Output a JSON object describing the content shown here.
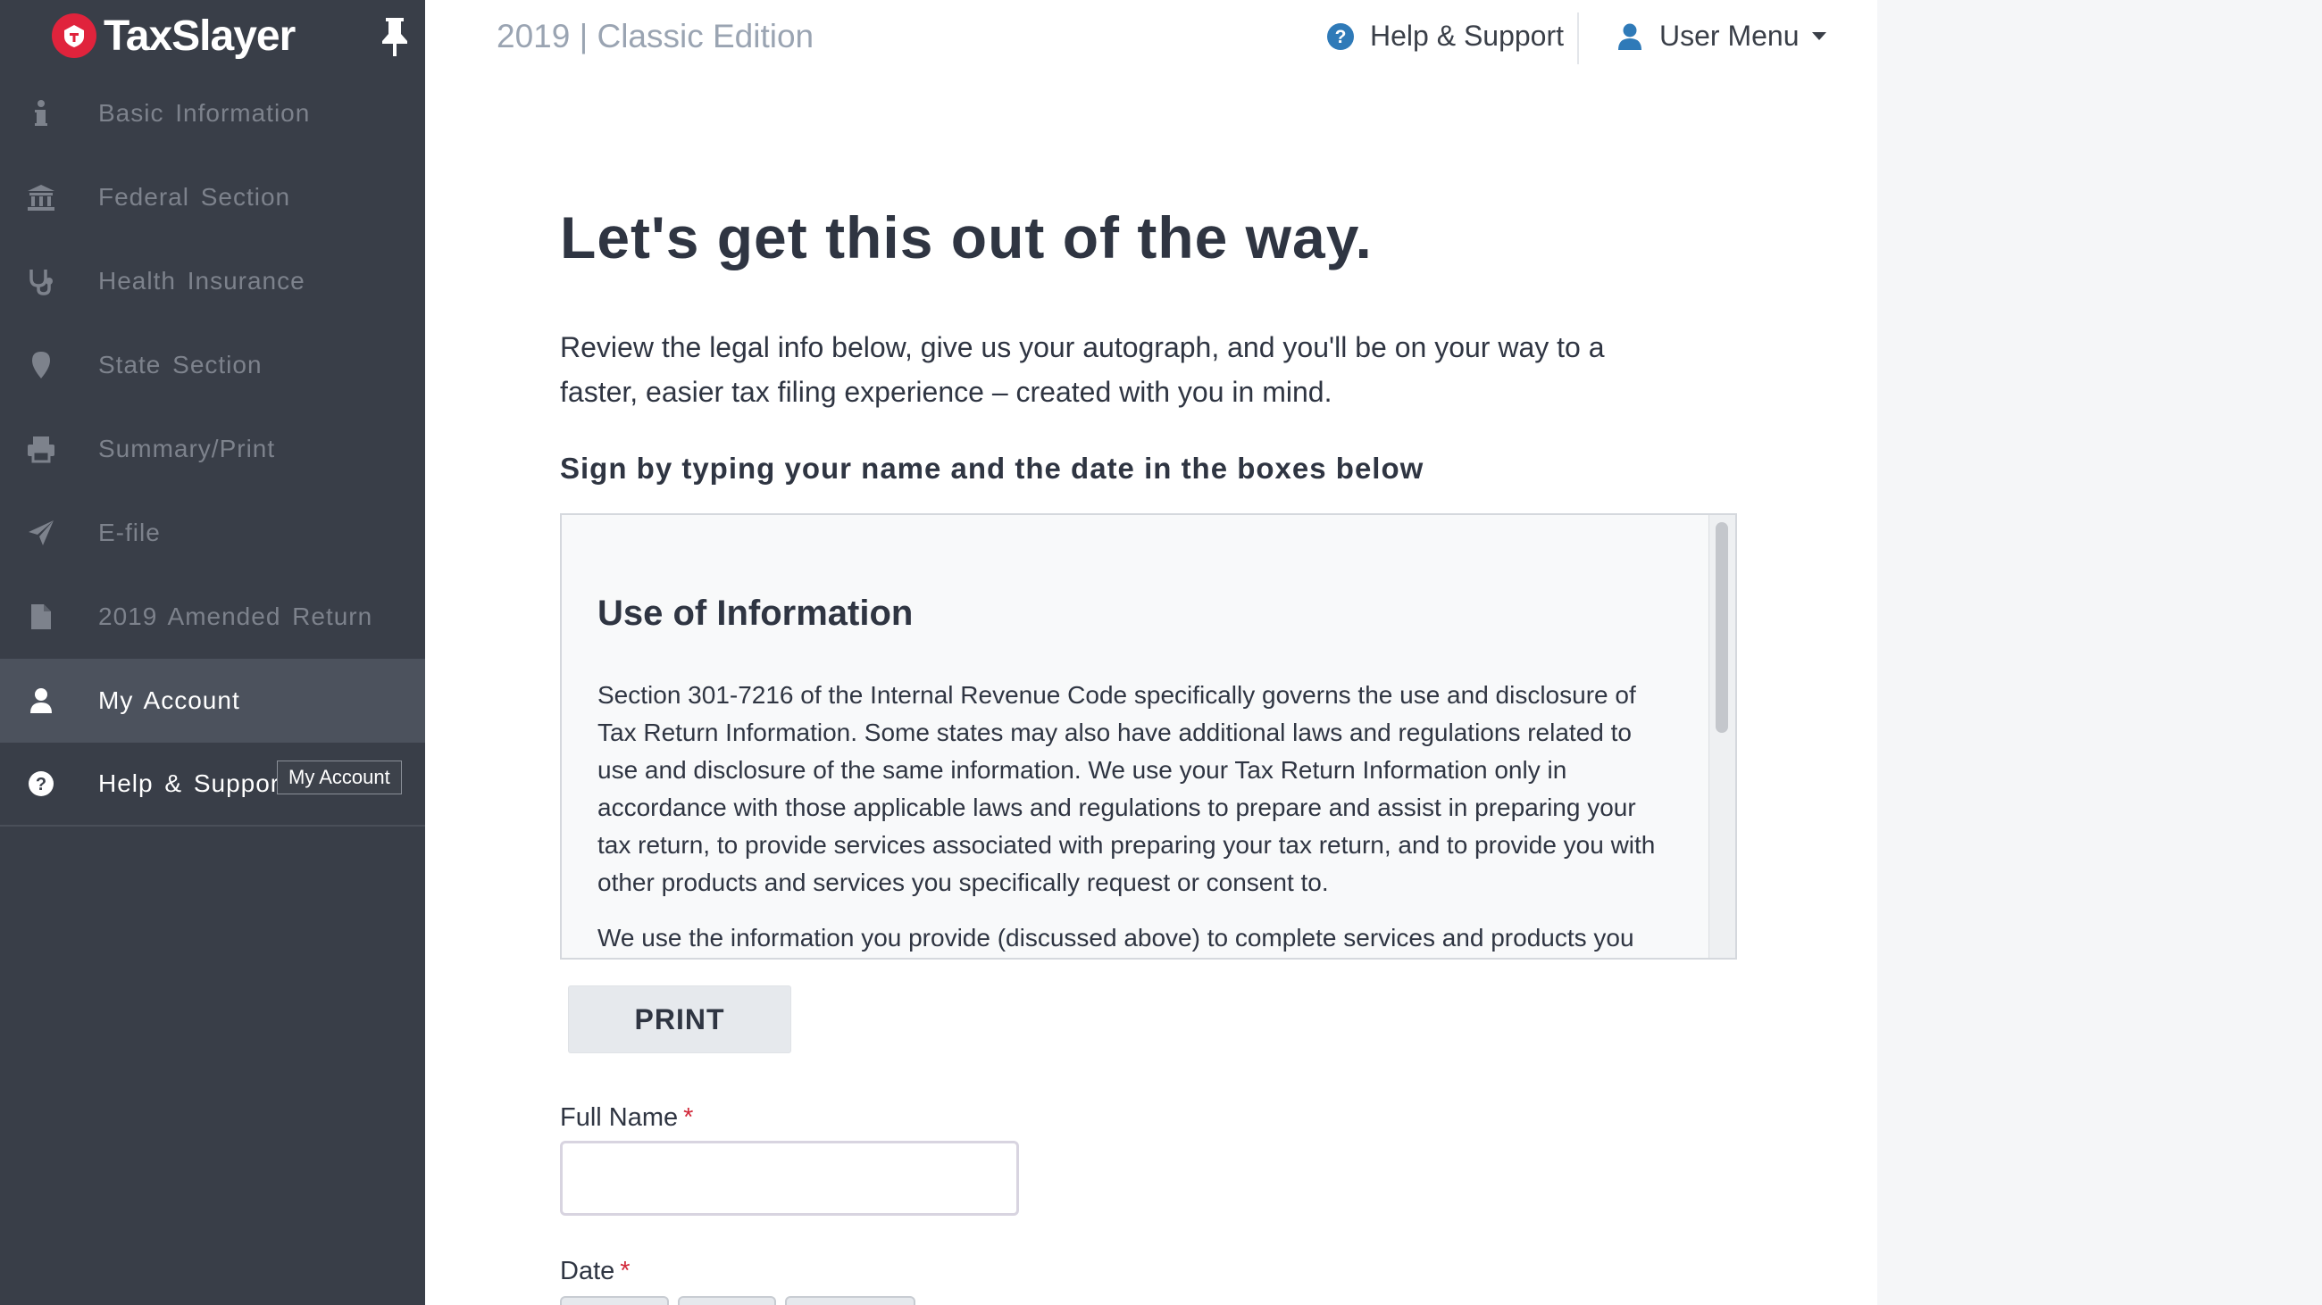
{
  "brand": {
    "name": "TaxSlayer"
  },
  "header": {
    "edition": "2019 | Classic Edition",
    "help_label": "Help & Support",
    "user_menu_label": "User Menu"
  },
  "sidebar": {
    "items": [
      {
        "label": "Basic Information",
        "icon": "info-icon"
      },
      {
        "label": "Federal Section",
        "icon": "bank-icon"
      },
      {
        "label": "Health Insurance",
        "icon": "stethoscope-icon"
      },
      {
        "label": "State Section",
        "icon": "map-marker-icon"
      },
      {
        "label": "Summary/Print",
        "icon": "printer-icon"
      },
      {
        "label": "E-file",
        "icon": "paper-plane-icon"
      },
      {
        "label": "2019 Amended Return",
        "icon": "file-icon"
      },
      {
        "label": "My Account",
        "icon": "user-icon"
      },
      {
        "label": "Help & Support",
        "icon": "question-circle-icon"
      }
    ],
    "tooltip": "My Account"
  },
  "main": {
    "heading": "Let's get this out of the way.",
    "intro": "Review the legal info below, give us your autograph, and you'll be on your way to a faster, easier tax filing experience – created with you in mind.",
    "subhead": "Sign by typing your name and the date in the boxes below",
    "legal": {
      "title": "Use of Information",
      "paragraphs": [
        "Section 301-7216 of the Internal Revenue Code specifically governs the use and disclosure of Tax Return Information. Some states may also have additional laws and regulations related to use and disclosure of the same information. We use your Tax Return Information only in accordance with those applicable laws and regulations to prepare and assist in preparing your tax return, to provide services associated with preparing your tax return, and to provide you with other products and services you specifically request or consent to.",
        "We use the information you provide (discussed above) to complete services and products you"
      ]
    },
    "print_label": "PRINT",
    "full_name_label": "Full Name",
    "full_name_value": "",
    "date_label": "Date",
    "required_mark": "*"
  },
  "colors": {
    "sidebar_bg": "#393e48",
    "sidebar_active": "#4c525d",
    "brand_red": "#e0233c",
    "help_icon_blue": "#2f7ab8",
    "required_red": "#d22a3b"
  }
}
